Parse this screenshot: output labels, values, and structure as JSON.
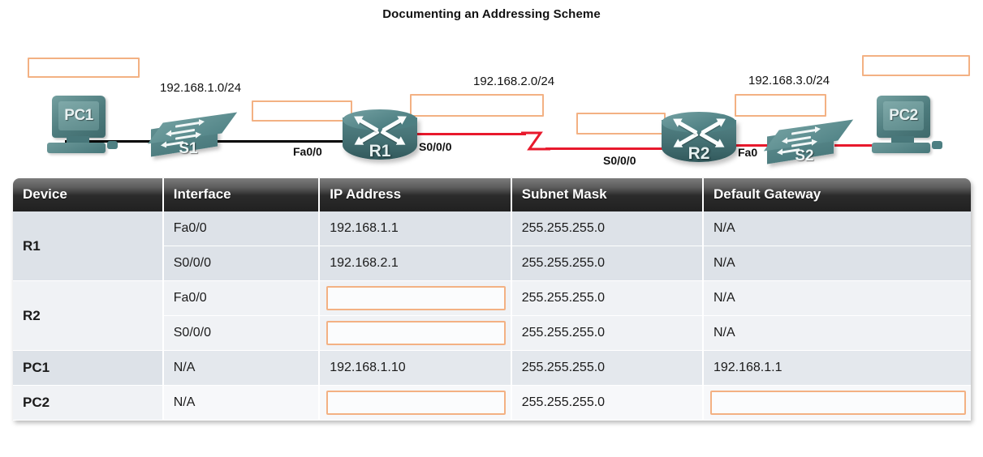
{
  "title": "Documenting an Addressing Scheme",
  "topology": {
    "networks": [
      {
        "label": "192.168.1.0/24"
      },
      {
        "label": "192.168.2.0/24"
      },
      {
        "label": "192.168.3.0/24"
      }
    ],
    "devices": [
      {
        "name": "PC1",
        "type": "pc"
      },
      {
        "name": "S1",
        "type": "switch"
      },
      {
        "name": "R1",
        "type": "router"
      },
      {
        "name": "R2",
        "type": "router"
      },
      {
        "name": "S2",
        "type": "switch"
      },
      {
        "name": "PC2",
        "type": "pc"
      }
    ],
    "interface_labels": [
      {
        "text": "Fa0/0"
      },
      {
        "text": "S0/0/0"
      },
      {
        "text": "S0/0/0"
      },
      {
        "text": "Fa0"
      }
    ],
    "blank_boxes": [
      {
        "id": "pc1-address-blank",
        "value": ""
      },
      {
        "id": "r1-fa00-blank",
        "value": ""
      },
      {
        "id": "r1-s000-blank",
        "value": ""
      },
      {
        "id": "r2-s000-blank",
        "value": ""
      },
      {
        "id": "r2-fa00-blank",
        "value": ""
      },
      {
        "id": "pc2-address-blank",
        "value": ""
      }
    ],
    "link_colors": {
      "ethernet": "#000000",
      "serial": "#e8192c"
    },
    "device_color": "#4d7f82",
    "blank_border_color": "#f3b183"
  },
  "table": {
    "headers": [
      "Device",
      "Interface",
      "IP Address",
      "Subnet Mask",
      "Default Gateway"
    ],
    "rows": [
      {
        "device": "R1",
        "interface": "Fa0/0",
        "ip": "192.168.1.1",
        "mask": "255.255.255.0",
        "gateway": "N/A"
      },
      {
        "device": "",
        "interface": "S0/0/0",
        "ip": "192.168.2.1",
        "mask": "255.255.255.0",
        "gateway": "N/A"
      },
      {
        "device": "R2",
        "interface": "Fa0/0",
        "ip": "",
        "mask": "255.255.255.0",
        "gateway": "N/A"
      },
      {
        "device": "",
        "interface": "S0/0/0",
        "ip": "",
        "mask": "255.255.255.0",
        "gateway": "N/A"
      },
      {
        "device": "PC1",
        "interface": "N/A",
        "ip": "192.168.1.10",
        "mask": "255.255.255.0",
        "gateway": "192.168.1.1"
      },
      {
        "device": "PC2",
        "interface": "N/A",
        "ip": "",
        "mask": "255.255.255.0",
        "gateway": ""
      }
    ]
  }
}
